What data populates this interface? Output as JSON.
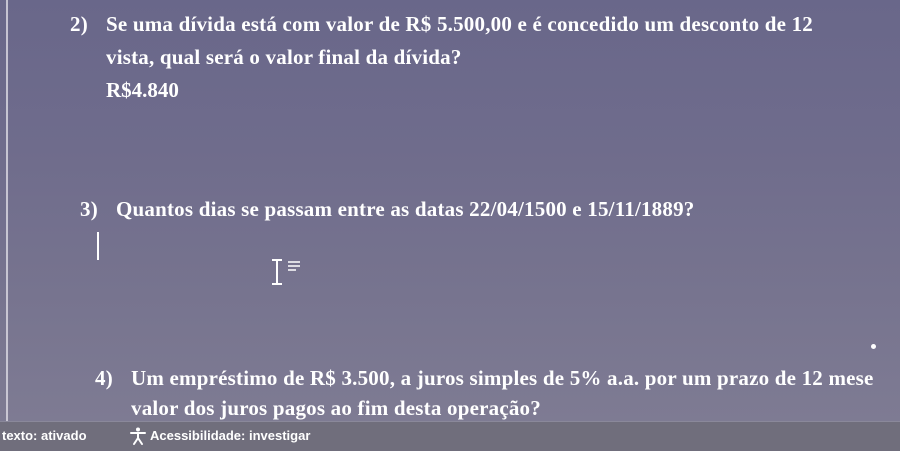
{
  "questions": [
    {
      "number": "2)",
      "line1": "Se uma dívida está com valor de R$ 5.500,00 e é concedido um desconto de 12",
      "line2": "vista, qual será o valor final da dívida?",
      "answer": "R$4.840"
    },
    {
      "number": "3)",
      "line1": "Quantos dias se passam entre as datas 22/04/1500 e 15/11/1889?"
    },
    {
      "number": "4)",
      "line1": "Um empréstimo de R$ 3.500, a juros simples de 5% a.a. por um prazo de 12 mese",
      "line2": "valor dos juros pagos ao fim desta operação?"
    }
  ],
  "statusbar": {
    "text_mode": "texto: ativado",
    "accessibility": "Acessibilidade: investigar"
  },
  "icons": {
    "cursor": "i-beam-cursor-icon",
    "accessibility": "accessibility-person-icon"
  }
}
